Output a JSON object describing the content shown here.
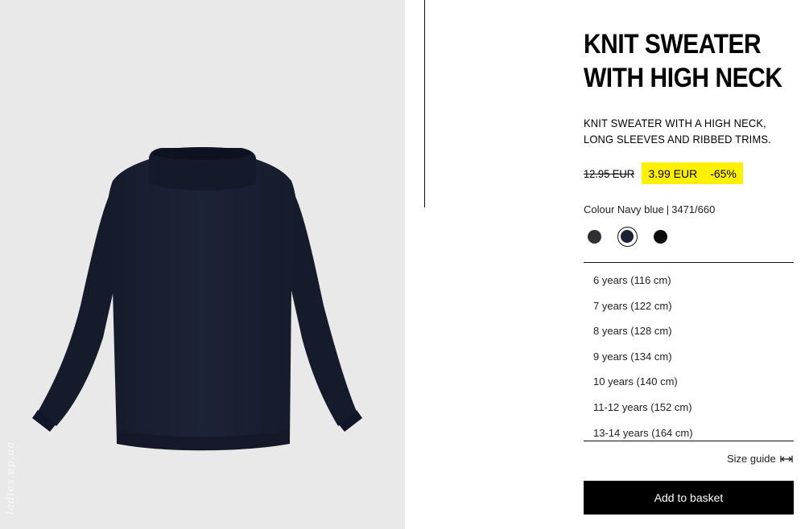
{
  "image": {
    "watermark": "ladies.ep.ua"
  },
  "product": {
    "title_line1": "KNIT SWEATER",
    "title_line2": "WITH HIGH NECK",
    "desc_line1": "KNIT SWEATER WITH A HIGH NECK,",
    "desc_line2": "LONG SLEEVES AND RIBBED TRIMS.",
    "old_price": "12.95 EUR",
    "price": "3.99 EUR",
    "discount": "-65%",
    "colour_label": "Colour Navy blue",
    "ref": "3471/660"
  },
  "colours": [
    {
      "name": "dark grey",
      "hex": "#2f3033",
      "selected": false
    },
    {
      "name": "navy blue",
      "hex": "#1c2233",
      "selected": true
    },
    {
      "name": "black",
      "hex": "#0c0c0c",
      "selected": false
    }
  ],
  "sizes": [
    "6 years (116 cm)",
    "7 years (122 cm)",
    "8 years (128 cm)",
    "9 years (134 cm)",
    "10 years (140 cm)",
    "11-12 years (152 cm)",
    "13-14 years (164 cm)"
  ],
  "size_guide_label": "Size guide",
  "basket_label": "Add to basket",
  "theme": {
    "sale_highlight": "#fff000",
    "sweater": "#1b2133"
  }
}
